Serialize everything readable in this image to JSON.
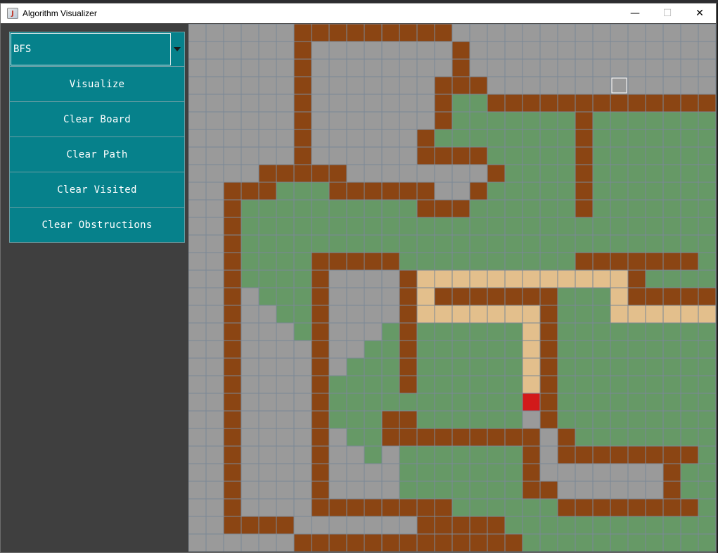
{
  "window": {
    "title": "Algorithm Visualizer",
    "controls": {
      "minimize": "—",
      "maximize": "☐",
      "close": "✕"
    },
    "app_icon_glyph": "J"
  },
  "sidebar": {
    "algorithm_select": {
      "value": "BFS",
      "icon": "chevron-down-icon"
    },
    "buttons": [
      {
        "id": "visualize",
        "label": "Visualize"
      },
      {
        "id": "clear-board",
        "label": "Clear Board"
      },
      {
        "id": "clear-path",
        "label": "Clear Path"
      },
      {
        "id": "clear-visited",
        "label": "Clear Visited"
      },
      {
        "id": "clear-obstructions",
        "label": "Clear Obstructions"
      }
    ]
  },
  "colors": {
    "empty": "#9a9a9a",
    "wall": "#8b4513",
    "visited": "#669966",
    "path": "#e3bf8c",
    "start": "#d21a1a",
    "end": "#00b0f0",
    "grid_line": "#7b8896",
    "button_bg": "#06818b"
  },
  "grid": {
    "legend": {
      ".": "empty",
      "W": "wall",
      "V": "visited",
      "P": "path",
      "S": "start",
      "E": "end"
    },
    "highlighted_cell": {
      "row": 3,
      "col": 24
    },
    "rows": [
      "......WWWWWWWWW.................",
      "......W........W................",
      "......W........W................",
      "......W.......WWW...............",
      "......W.......WVVWWWWWWWWWWWWWWW",
      "......W.......WVVVVVVVWVVVVVVVVW",
      "......W......WVVVVVVVVWVVVVVVVVW",
      "......W......WWWWVVVVVWVVVVVVVVW",
      "....WWWWW........WVVVVWVVVVVVVVW",
      "..WWWVVVWWWWWW..WVVVVVWVVVVVVVVW",
      "..WVVVVVVVVVVWWWVVVVVVWVVVVVVVVW",
      "..WVVVVVVVVVVVVVVVVVVVVVVVVVVVVW",
      "..WVVVVVVVVVVVVVVVVVVVVVVVVVVVVW",
      "..WVVVVWWWWWVVVVVVVVVVWWWWWWWVVV",
      "..WVVVVW....WPPPPPPPPPPPPWVVVVVV",
      "..W.VVVW....WPWWWWWWWVVVPWWWWWVV",
      "..W..VVW....WPPPPPPPWVVVPPPPPPPE",
      "..W...VW...VWVVVVVVPWVVVVVVVVVVV",
      "..W....W..VVWVVVVVVPWVVVVVVVVVVV",
      "..W....W.VVVWVVVVVVPWVVVVVVVVVVV",
      "..W....WVVVVWVVVVVVPWVVVVVVVVVVV",
      "..W....WVVVVVVVVVVVSWVVVVVVVVVVV",
      "..W....WVVVWWVVVVVV.WVVVVVVVVVVV",
      "..W....W.VVWWWWWWWWW.WVVVVVVVVVV",
      "..W....W..V.VVVVVVVW.WWWWWWWWVVV",
      "..W....W....VVVVVVVW.......WVVVV",
      "..W....W....VVVVVVVWW......WVVVV",
      "..W....WWWWWWWWVVVVVVWWWWWWWWVVV",
      "..WWWW.......WWWWWVVVVVVVVVVVVVV",
      "......WWWWWWWWWWWWWVVVVVVVVVVVVV"
    ]
  }
}
